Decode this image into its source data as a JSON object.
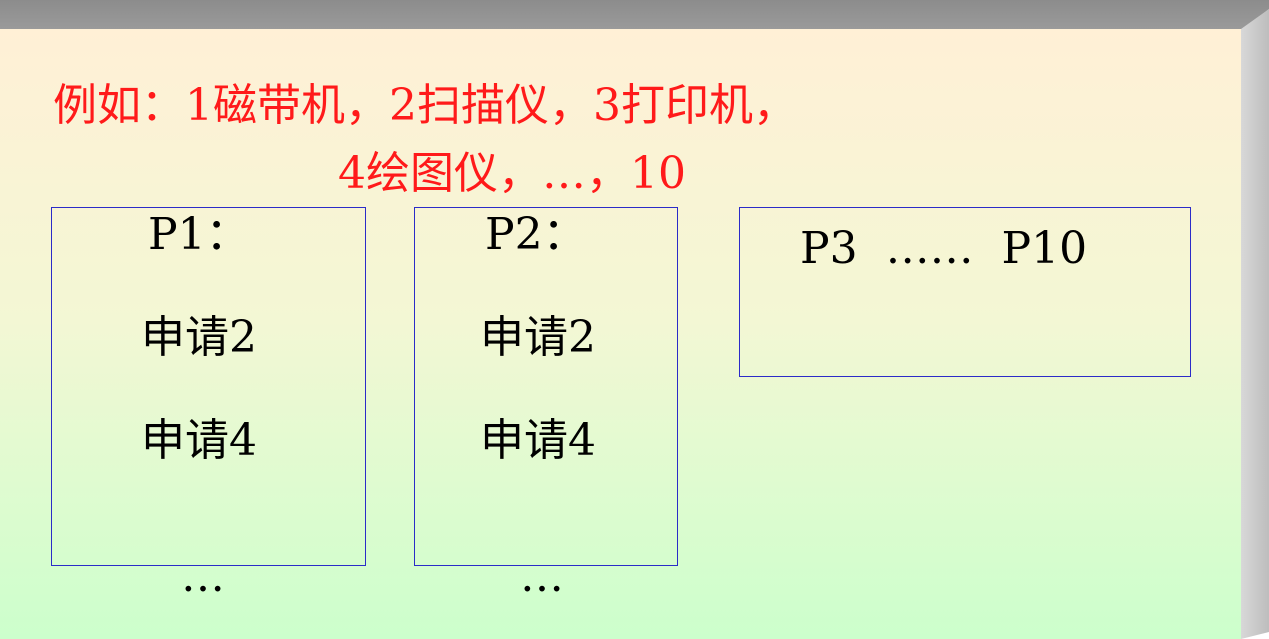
{
  "example": {
    "line1": "例如：1磁带机，2扫描仪，3打印机，",
    "line2": "4绘图仪，…，10"
  },
  "processes": [
    {
      "label": "P1：",
      "requests": [
        "申请2",
        "申请4"
      ],
      "more": "…"
    },
    {
      "label": "P2：",
      "requests": [
        "申请2",
        "申请4"
      ],
      "more": "…"
    },
    {
      "label": "P3  ……  P10"
    }
  ],
  "colors": {
    "highlight_text": "#ff1a1a",
    "box_border": "#2b2bc8",
    "background_top": "#fff0d6",
    "background_bottom": "#ccffcc"
  }
}
